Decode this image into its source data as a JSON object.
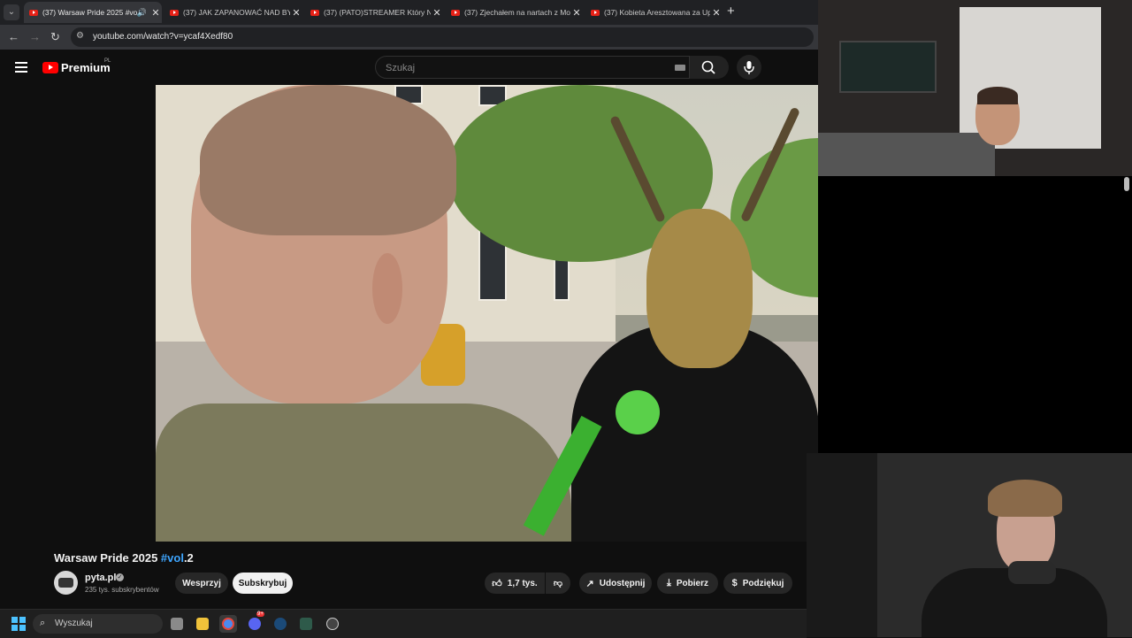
{
  "browser": {
    "tabs": [
      {
        "title": "(37) Warsaw Pride 2025 #vo",
        "active": true
      },
      {
        "title": "(37) JAK ZAPANOWAĆ NAD BY"
      },
      {
        "title": "(37) (PATO)STREAMER Który Ni"
      },
      {
        "title": "(37) Zjechałem na nartach z Mo"
      },
      {
        "title": "(37) Kobieta Aresztowana za Up"
      }
    ],
    "close_glyph": "✕",
    "new_tab_glyph": "+",
    "url": "youtube.com/watch?v=ycaf4Xedf80"
  },
  "youtube": {
    "logo_text": "Premium",
    "logo_region": "PL",
    "search_placeholder": "Szukaj"
  },
  "video": {
    "title_main": "Warsaw Pride 2025 ",
    "title_hashtag": "#vol",
    "title_suffix": ".2",
    "channel_name": "pyta.pl",
    "subscribers": "235 tys. subskrybentów",
    "join_label": "Wesprzyj",
    "subscribe_label": "Subskrybuj",
    "likes": "1,7 tys.",
    "share_label": "Udostępnij",
    "download_label": "Pobierz",
    "thanks_label": "Podziękuj"
  },
  "taskbar": {
    "search_label": "Wyszukaj",
    "notification_badge": "9+"
  },
  "colors": {
    "accent_blue": "#3ea6ff",
    "youtube_red": "#ff0000",
    "background": "#0f0f0f"
  }
}
